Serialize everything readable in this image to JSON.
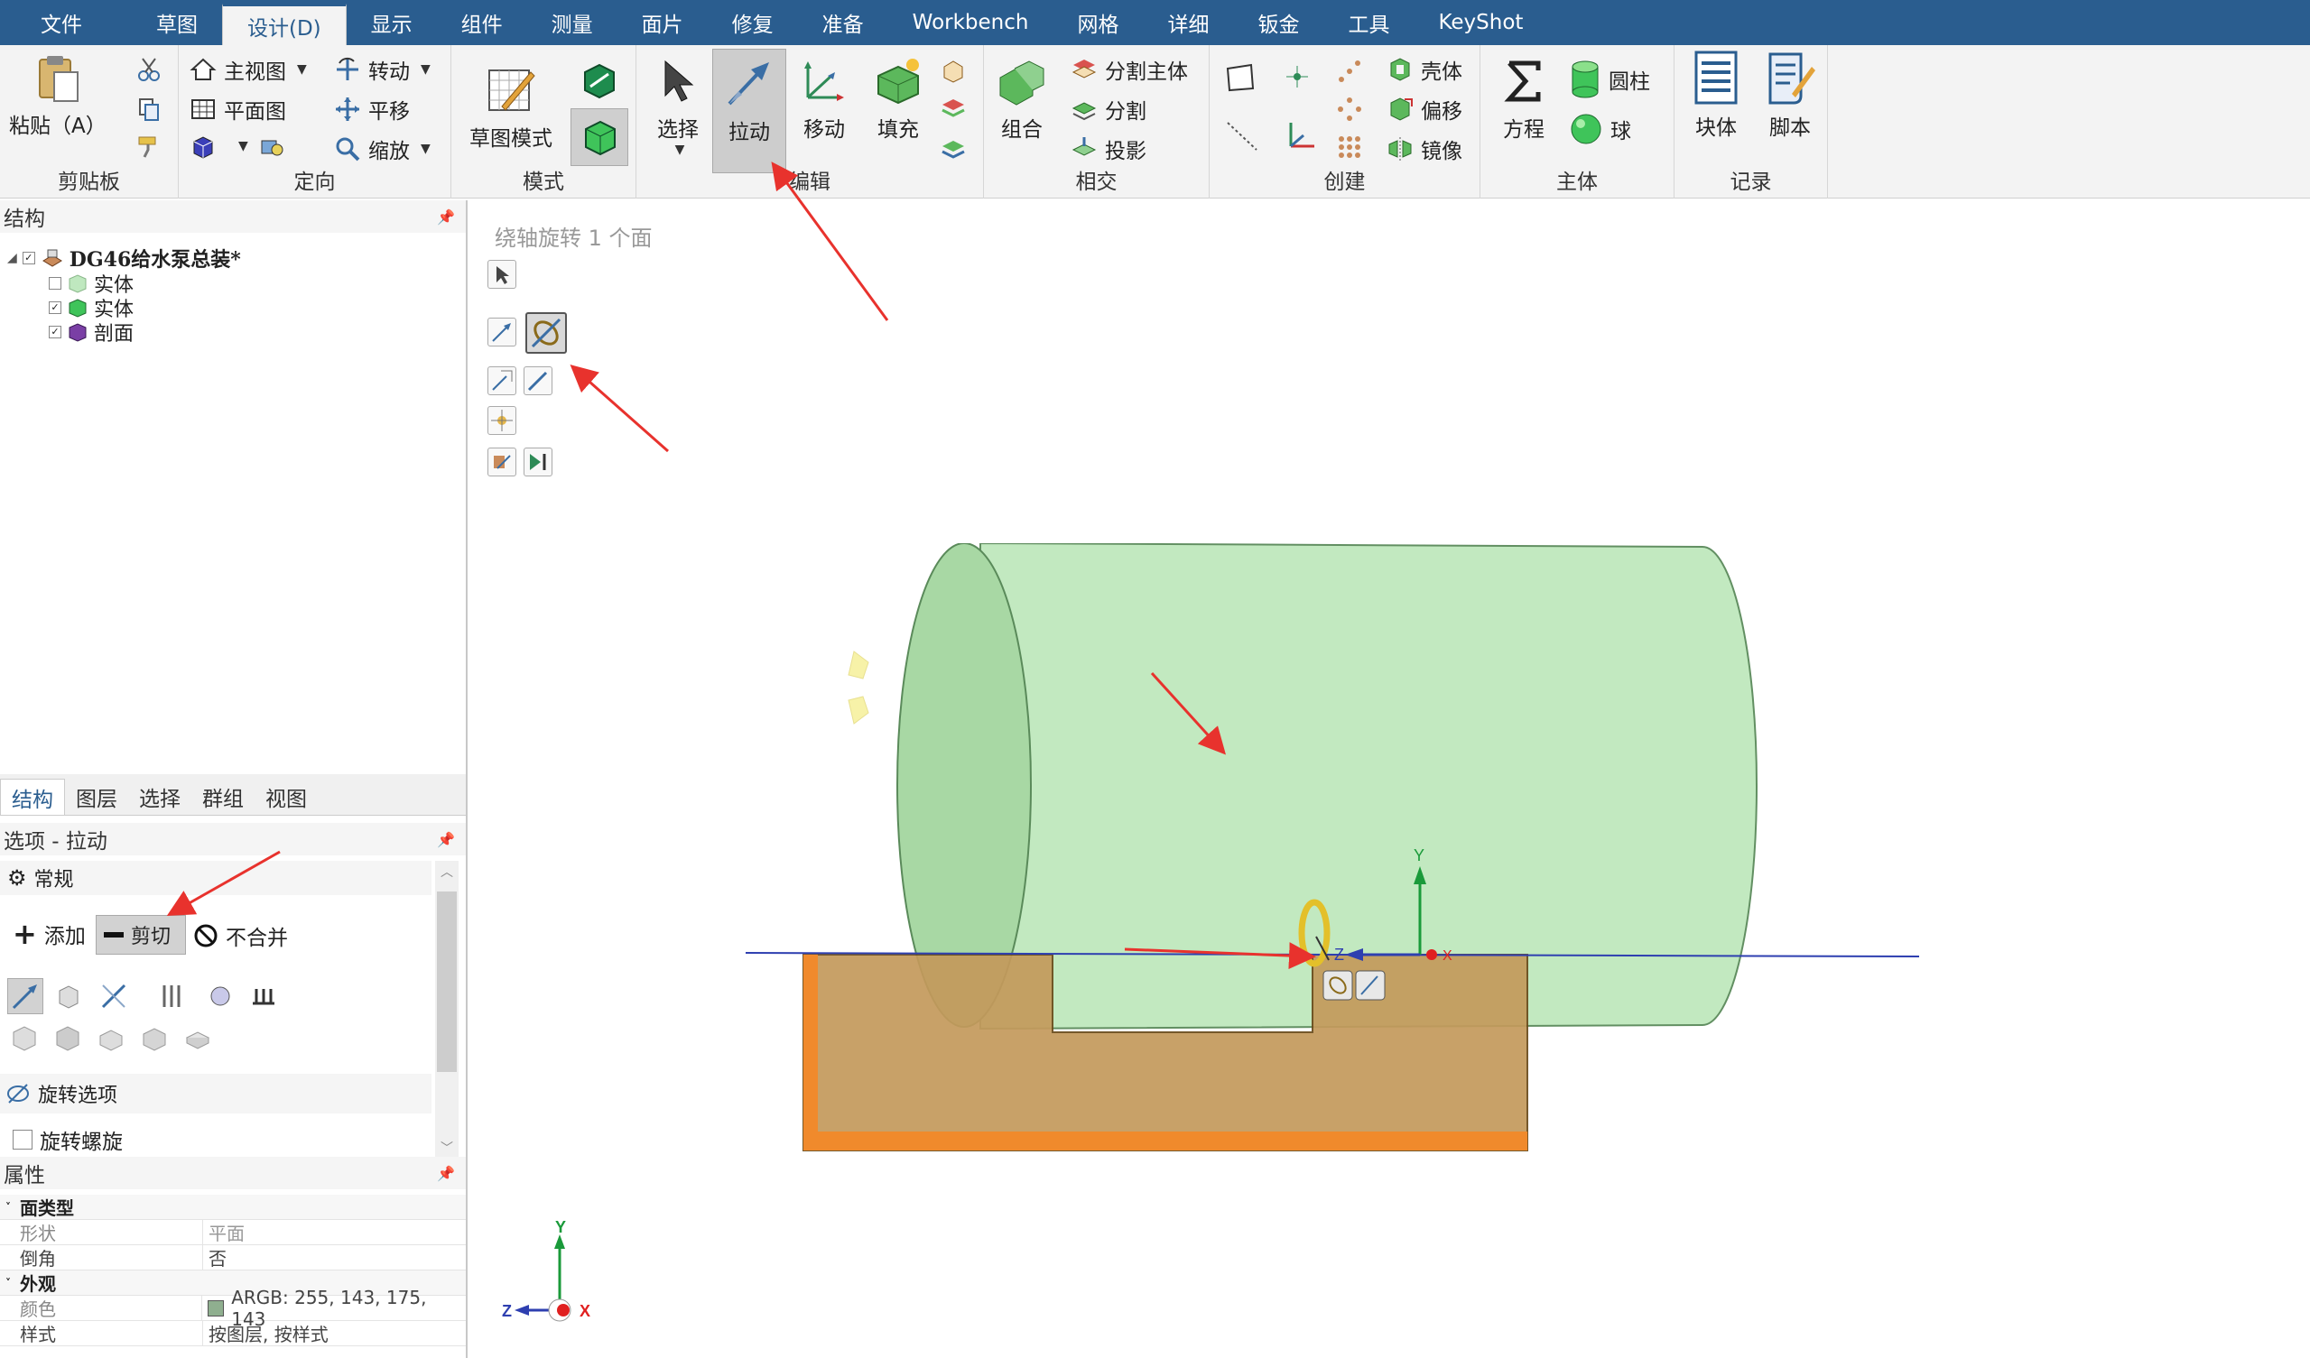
{
  "menu": {
    "tabs": [
      "文件",
      "草图",
      "设计(D)",
      "显示",
      "组件",
      "测量",
      "面片",
      "修复",
      "准备",
      "Workbench",
      "网格",
      "详细",
      "钣金",
      "工具",
      "KeyShot"
    ],
    "active_index": 2
  },
  "ribbon": {
    "clipboard": {
      "title": "剪贴板",
      "paste": "粘贴（A）"
    },
    "orient": {
      "title": "定向",
      "home": "主视图",
      "plan": "平面图",
      "rotate": "转动",
      "pan": "平移",
      "zoom": "缩放"
    },
    "mode": {
      "title": "模式",
      "sketch": "草图模式"
    },
    "edit": {
      "title": "编辑",
      "select": "选择",
      "pull": "拉动",
      "move": "移动",
      "fill": "填充"
    },
    "intersect": {
      "title": "相交",
      "combine": "组合",
      "split_body": "分割主体",
      "split": "分割",
      "project": "投影"
    },
    "create": {
      "title": "创建",
      "shell": "壳体",
      "offset": "偏移",
      "mirror": "镜像"
    },
    "body": {
      "title": "主体",
      "equation": "方程",
      "cylinder": "圆柱",
      "sphere": "球"
    },
    "record": {
      "title": "记录",
      "block": "块体",
      "script": "脚本"
    }
  },
  "structure": {
    "title": "结构",
    "root": "DG46给水泵总装*",
    "items": [
      "实体",
      "实体",
      "剖面"
    ]
  },
  "panel_tabs": [
    "结构",
    "图层",
    "选择",
    "群组",
    "视图"
  ],
  "options": {
    "title": "选项 - 拉动",
    "section_general": "常规",
    "add": "添加",
    "cut": "剪切",
    "no_merge": "不合并",
    "rotate_options": "旋转选项",
    "rotate_helix": "旋转螺旋"
  },
  "properties": {
    "title": "属性",
    "cat1": "面类型",
    "shape_k": "形状",
    "shape_v": "平面",
    "chamfer_k": "倒角",
    "chamfer_v": "否",
    "cat2": "外观",
    "color_k": "颜色",
    "color_v": "ARGB: 255, 143, 175, 143",
    "style_k": "样式",
    "style_v": "按图层, 按样式"
  },
  "viewport": {
    "hint": "绕轴旋转 1 个面",
    "axis_y": "Y",
    "axis_z": "Z",
    "axis_x": "X"
  },
  "colors": {
    "menubar": "#2a5d8f",
    "cylinder": "#b6e2b2",
    "solid_body": "#c49a5c",
    "highlight_face": "#f08a2c",
    "annotation": "#e8322d"
  }
}
